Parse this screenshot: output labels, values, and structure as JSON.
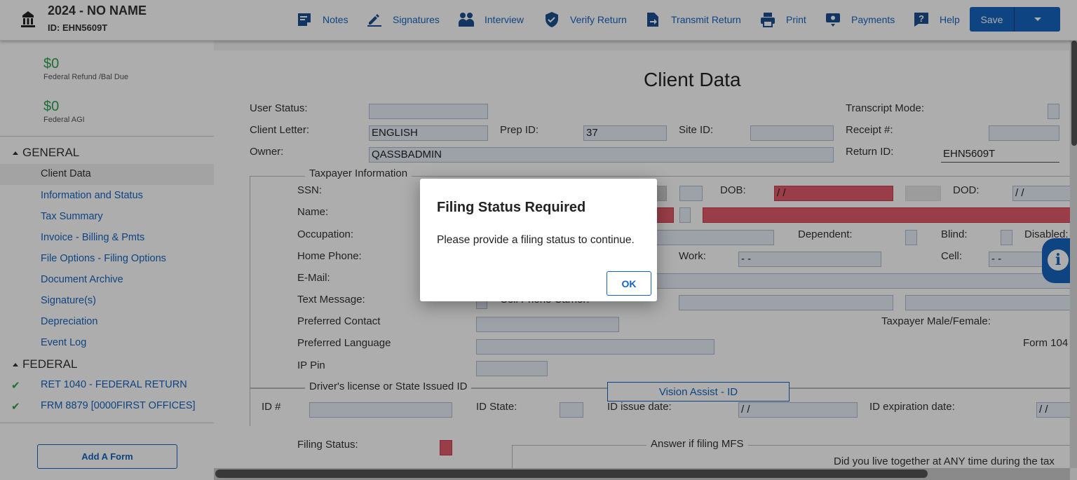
{
  "header": {
    "title": "2024 - NO NAME",
    "return_id": "ID: EHN5609T",
    "nav": [
      {
        "label": "Notes",
        "icon": "notes-icon"
      },
      {
        "label": "Signatures",
        "icon": "signature-icon"
      },
      {
        "label": "Interview",
        "icon": "interview-icon"
      },
      {
        "label": "Verify Return",
        "icon": "shield-check-icon"
      },
      {
        "label": "Transmit Return",
        "icon": "transmit-icon"
      },
      {
        "label": "Print",
        "icon": "printer-icon"
      },
      {
        "label": "Payments",
        "icon": "payments-icon"
      },
      {
        "label": "Help",
        "icon": "help-icon"
      }
    ],
    "save_label": "Save"
  },
  "sidebar": {
    "refund_amount": "$0",
    "refund_label": "Federal Refund /Bal Due",
    "agi_amount": "$0",
    "agi_label": "Federal AGI",
    "general_heading": "GENERAL",
    "general_items": [
      {
        "label": "Client Data",
        "active": true
      },
      {
        "label": "Information and Status"
      },
      {
        "label": "Tax Summary"
      },
      {
        "label": "Invoice - Billing & Pmts"
      },
      {
        "label": "File Options - Filing Options"
      },
      {
        "label": "Document Archive"
      },
      {
        "label": "Signature(s)"
      },
      {
        "label": "Depreciation"
      },
      {
        "label": "Event Log"
      }
    ],
    "federal_heading": "FEDERAL",
    "federal_items": [
      {
        "label": "RET 1040 - FEDERAL RETURN",
        "checked": true
      },
      {
        "label": "FRM 8879 [0000FIRST OFFICES]",
        "checked": true
      }
    ],
    "add_form_label": "Add A Form"
  },
  "form": {
    "title": "Client Data",
    "user_status_label": "User Status:",
    "client_letter_label": "Client Letter:",
    "client_letter_value": "ENGLISH",
    "owner_label": "Owner:",
    "owner_value": "QASSBADMIN",
    "prep_id_label": "Prep ID:",
    "prep_id_value": "37",
    "site_id_label": "Site ID:",
    "transcript_mode_label": "Transcript Mode:",
    "receipt_label": "Receipt #:",
    "return_id_label": "Return ID:",
    "return_id_value": "EHN5609T",
    "taxpayer_info_title": "Taxpayer Information",
    "ssn_label": "SSN:",
    "dob_label": "DOB:",
    "dob_value": "/  /",
    "dod_label": "DOD:",
    "dod_value": "/  /",
    "name_label": "Name:",
    "occupation_label": "Occupation:",
    "dependent_label": "Dependent:",
    "blind_label": "Blind:",
    "disabled_label": "Disabled:",
    "home_phone_label": "Home Phone:",
    "work_label": "Work:",
    "work_value": "-   -",
    "cell_label": "Cell:",
    "cell_value": "-   -",
    "email_label": "E-Mail:",
    "text_message_label": "Text Message:",
    "cell_carrier_label": "Cell Phone Carrier:",
    "preferred_contact_label": "Preferred Contact",
    "taxpayer_gender_label": "Taxpayer Male/Female:",
    "preferred_language_label": "Preferred Language",
    "form_104_label": "Form 104",
    "ip_pin_label": "IP Pin",
    "dl_title": "Driver's license or State Issued ID",
    "vision_assist_label": "Vision Assist - ID",
    "id_num_label": "ID #",
    "id_state_label": "ID State:",
    "id_issue_label": "ID issue date:",
    "id_issue_value": "/  /",
    "id_exp_label": "ID expiration date:",
    "id_exp_value": "/  /",
    "filing_status_label": "Filing Status:",
    "mfs_title": "Answer if filing MFS",
    "mfs_question": "Did you live together at ANY time during the tax"
  },
  "dialog": {
    "title": "Filing Status Required",
    "message": "Please provide a filing status to continue.",
    "ok_label": "OK"
  },
  "colors": {
    "accent": "#1565c0",
    "required": "#e25c6a",
    "positive": "#2ea44f"
  }
}
